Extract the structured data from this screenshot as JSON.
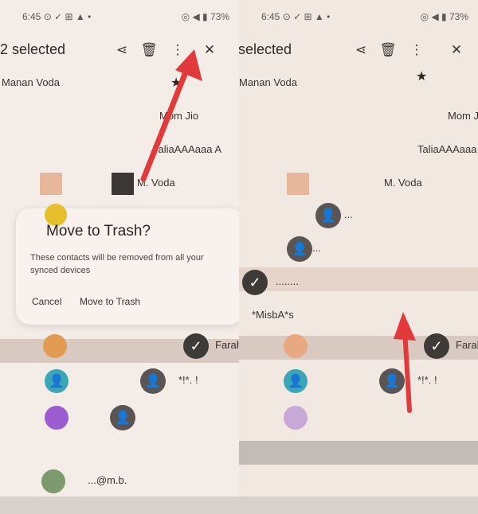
{
  "status": {
    "left": "6:45 ⊙ ✓ ⊞ ▲ •",
    "right": "◎ ◀ ▮ 73%"
  },
  "selection": {
    "title": "2 selected"
  },
  "left_list": [
    {
      "name": "Manan Voda"
    },
    {
      "name": "Mom Jio"
    },
    {
      "name": "TaliaAAAaaa A"
    },
    {
      "name": "M. Voda"
    },
    {
      "name": "Farah"
    },
    {
      "name": "*!*. !"
    },
    {
      "name": "...@m.b."
    }
  ],
  "right_list": [
    {
      "name": "Manan Voda"
    },
    {
      "name": "Mom Jio"
    },
    {
      "name": "TaliaAAAaaa A"
    },
    {
      "name": "M. Voda"
    },
    {
      "name": "..."
    },
    {
      "name": "..."
    },
    {
      "name": "........"
    },
    {
      "name": "*MisbA*s"
    },
    {
      "name": "Farah *"
    },
    {
      "name": "*!*. !"
    }
  ],
  "dialog": {
    "title": "Move to Trash?",
    "body": "These contacts will be removed from all your synced devices",
    "cancel": "Cancel",
    "confirm": "Move to Trash"
  },
  "colors": {
    "accent_arrow": "#e23a3a",
    "check_bg": "#3d3a38",
    "avatar_teal": "#3ba6b6",
    "avatar_purple": "#9b5bd1",
    "avatar_yellow": "#e6c02c",
    "avatar_orange": "#e39a52"
  },
  "icons": [
    "share-icon",
    "trash-icon",
    "more-vert-icon",
    "close-icon",
    "star-icon",
    "check-icon",
    "person-icon"
  ]
}
